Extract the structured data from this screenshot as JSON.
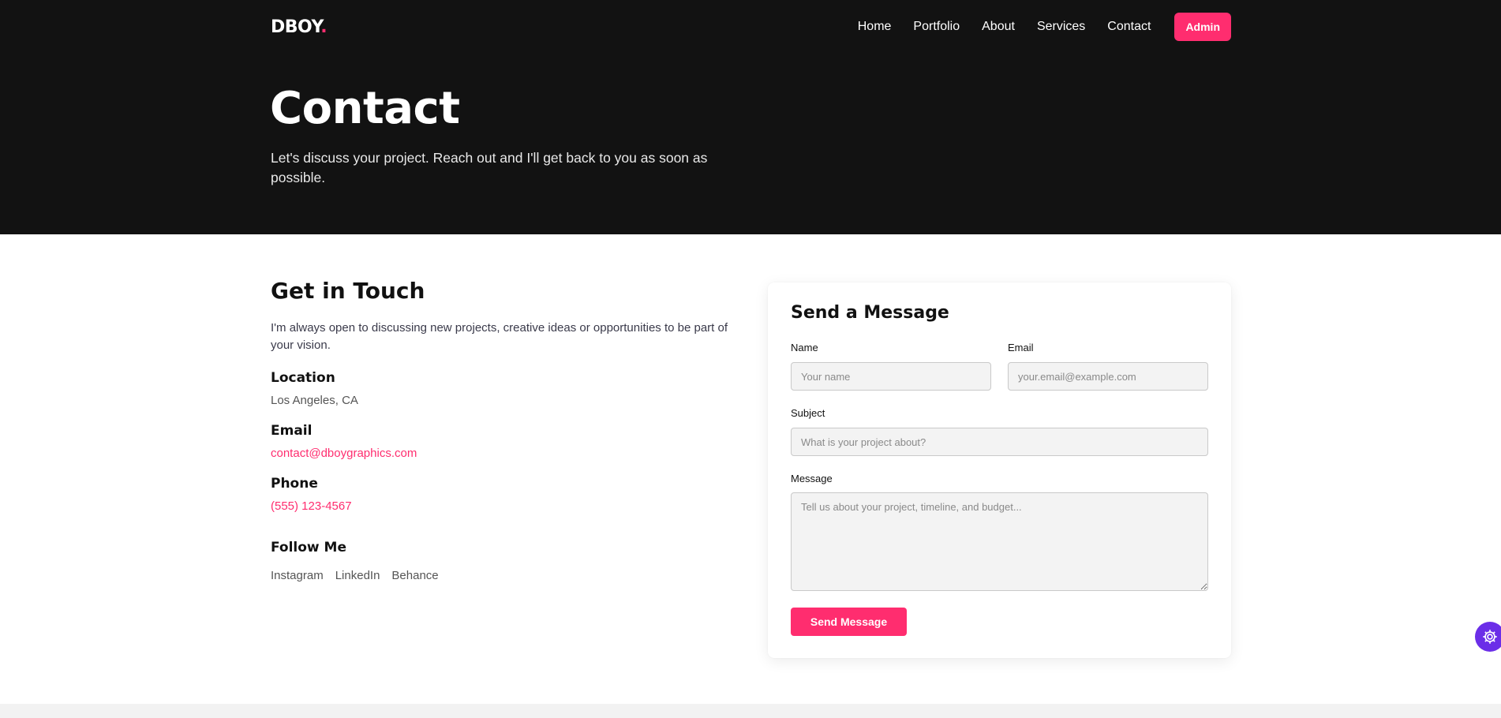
{
  "brand": {
    "name": "DBOY",
    "dot": "."
  },
  "nav": {
    "links": [
      "Home",
      "Portfolio",
      "About",
      "Services",
      "Contact"
    ],
    "admin_label": "Admin"
  },
  "hero": {
    "title": "Contact",
    "subtitle": "Let's discuss your project. Reach out and I'll get back to you as soon as possible."
  },
  "touch": {
    "title": "Get in Touch",
    "description": "I'm always open to discussing new projects, creative ideas or opportunities to be part of your vision.",
    "location_label": "Location",
    "location_value": "Los Angeles, CA",
    "email_label": "Email",
    "email_value": "contact@dboygraphics.com",
    "phone_label": "Phone",
    "phone_value": "(555) 123-4567",
    "follow_label": "Follow Me",
    "socials": [
      "Instagram",
      "LinkedIn",
      "Behance"
    ]
  },
  "form": {
    "title": "Send a Message",
    "name_label": "Name",
    "name_placeholder": "Your name",
    "email_label": "Email",
    "email_placeholder": "your.email@example.com",
    "subject_label": "Subject",
    "subject_placeholder": "What is your project about?",
    "message_label": "Message",
    "message_placeholder": "Tell us about your project, timeline, and budget...",
    "submit_label": "Send Message"
  },
  "colors": {
    "accent": "#ff2d6f",
    "hero_bg": "#121212",
    "fab": "#6b2ee8"
  },
  "icons": {
    "fab": "gear-icon"
  }
}
